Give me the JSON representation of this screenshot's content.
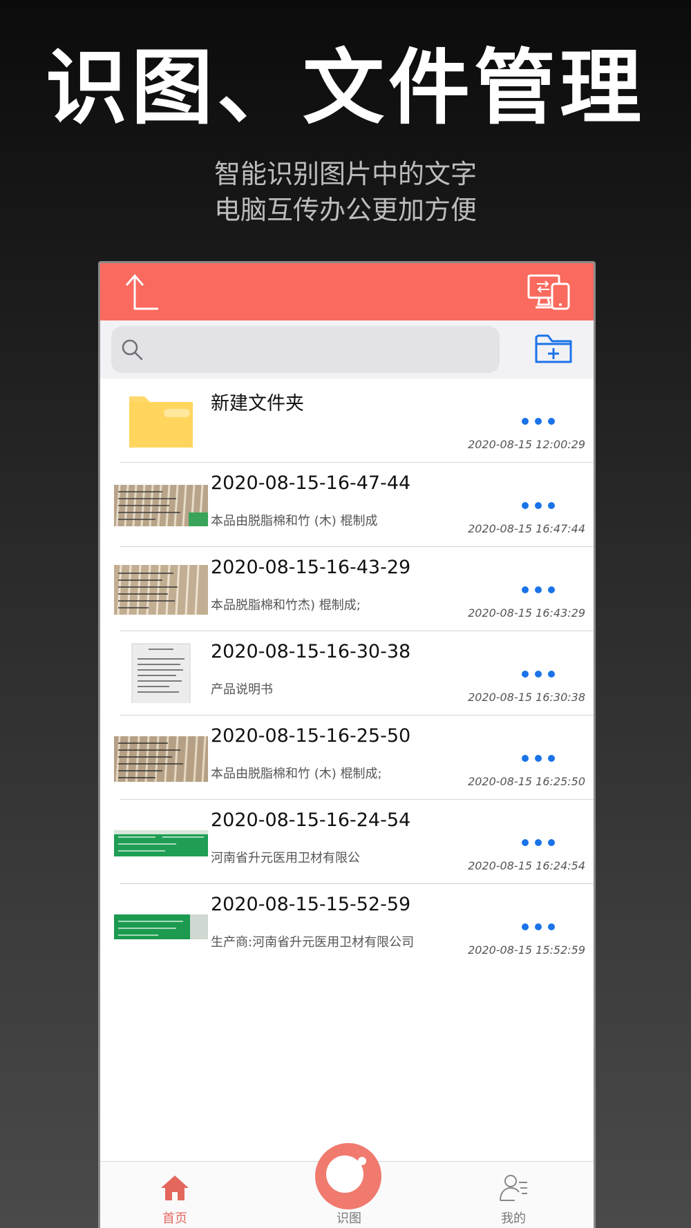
{
  "hero": {
    "title": "识图、文件管理",
    "subtitle_line1": "智能识别图片中的文字",
    "subtitle_line2": "电脑互传办公更加方便"
  },
  "navbar": {
    "back_icon": "upload-arrow-icon",
    "transfer_icon": "pc-phone-transfer-icon",
    "accent": "#fb6a5e"
  },
  "search": {
    "placeholder": "",
    "value": ""
  },
  "list": {
    "folder": {
      "title": "新建文件夹",
      "date": "2020-08-15 12:00:29"
    },
    "items": [
      {
        "title": "2020-08-15-16-47-44",
        "snippet": "本品由脱脂棉和竹 (木) 棍制成",
        "date": "2020-08-15 16:47:44"
      },
      {
        "title": "2020-08-15-16-43-29",
        "snippet": "本品脱脂棉和竹杰) 棍制成;",
        "date": "2020-08-15 16:43:29"
      },
      {
        "title": "2020-08-15-16-30-38",
        "snippet": "产品说明书",
        "date": "2020-08-15 16:30:38"
      },
      {
        "title": "2020-08-15-16-25-50",
        "snippet": "本品由脱脂棉和竹 (木) 棍制成;",
        "date": "2020-08-15 16:25:50"
      },
      {
        "title": "2020-08-15-16-24-54",
        "snippet": "河南省升元医用卫材有限公",
        "date": "2020-08-15 16:24:54"
      },
      {
        "title": "2020-08-15-15-52-59",
        "snippet": "生产商:河南省升元医用卫材有限公司",
        "date": "2020-08-15 15:52:59"
      }
    ]
  },
  "tabbar": {
    "home": "首页",
    "scan": "识图",
    "me": "我的",
    "active_color": "#e4675d"
  }
}
